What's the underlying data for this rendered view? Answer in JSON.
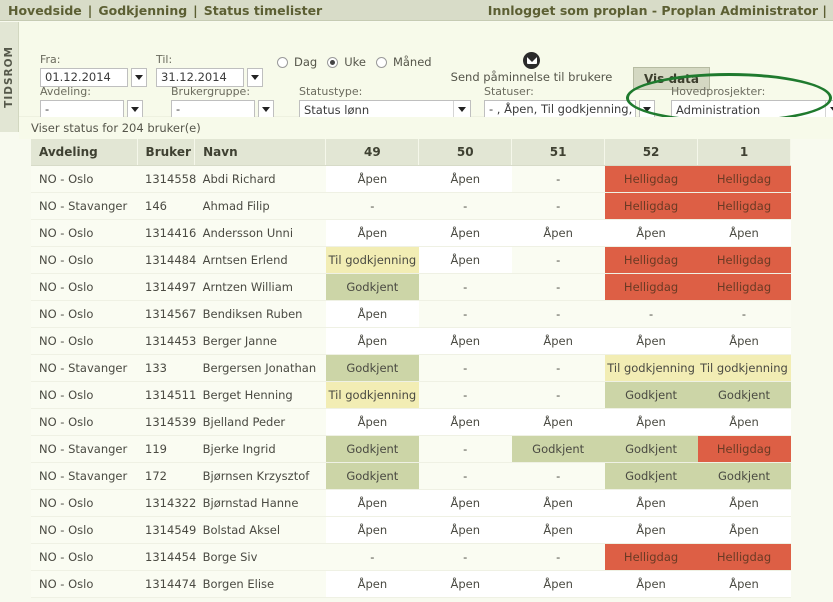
{
  "topbar": {
    "nav": [
      "Hovedside",
      "Godkjenning",
      "Status timelister"
    ],
    "separator": "|",
    "right_text": "Innlogget som proplan - Proplan Administrator |"
  },
  "sidetab": {
    "label": "TIDSROM"
  },
  "filters": {
    "fra": {
      "label": "Fra:",
      "value": "01.12.2014"
    },
    "til": {
      "label": "Til:",
      "value": "31.12.2014"
    },
    "period": {
      "options": [
        "Dag",
        "Uke",
        "Måned"
      ],
      "selected": "Uke"
    },
    "send_reminder": {
      "label": "Send påminnelse til brukere",
      "icon": "envelope-icon"
    },
    "vis_data": {
      "label": "Vis data"
    },
    "avdeling": {
      "label": "Avdeling:",
      "value": "-"
    },
    "brukergruppe": {
      "label": "Brukergruppe:",
      "value": "-"
    },
    "statustype": {
      "label": "Statustype:",
      "value": "Status lønn"
    },
    "statuser": {
      "label": "Statuser:",
      "value": "- , Åpen, Til godkjenning, G"
    },
    "hovedprosjekter": {
      "label": "Hovedprosjekter:",
      "value": "Administration"
    }
  },
  "status_line": "Viser status for 204 bruker(e)",
  "table": {
    "headers": [
      "Avdeling",
      "Bruker",
      "Navn",
      "49",
      "50",
      "51",
      "52",
      "1"
    ],
    "rows": [
      {
        "avdeling": "NO - Oslo",
        "bruker": "1314558",
        "navn": "Abdi Richard",
        "weeks": [
          "Åpen",
          "Åpen",
          "-",
          "Helligdag",
          "Helligdag"
        ]
      },
      {
        "avdeling": "NO - Stavanger",
        "bruker": "146",
        "navn": "Ahmad Filip",
        "weeks": [
          "-",
          "-",
          "-",
          "Helligdag",
          "Helligdag"
        ]
      },
      {
        "avdeling": "NO - Oslo",
        "bruker": "1314416",
        "navn": "Andersson Unni",
        "weeks": [
          "Åpen",
          "Åpen",
          "Åpen",
          "Åpen",
          "Åpen"
        ]
      },
      {
        "avdeling": "NO - Oslo",
        "bruker": "1314484",
        "navn": "Arntsen Erlend",
        "weeks": [
          "Til godkjenning",
          "Åpen",
          "-",
          "Helligdag",
          "Helligdag"
        ]
      },
      {
        "avdeling": "NO - Oslo",
        "bruker": "1314497",
        "navn": "Arntzen William",
        "weeks": [
          "Godkjent",
          "-",
          "-",
          "Helligdag",
          "Helligdag"
        ]
      },
      {
        "avdeling": "NO - Oslo",
        "bruker": "1314567",
        "navn": "Bendiksen Ruben",
        "weeks": [
          "Åpen",
          "-",
          "-",
          "-",
          "-"
        ]
      },
      {
        "avdeling": "NO - Oslo",
        "bruker": "1314453",
        "navn": "Berger Janne",
        "weeks": [
          "Åpen",
          "Åpen",
          "Åpen",
          "Åpen",
          "Åpen"
        ]
      },
      {
        "avdeling": "NO - Stavanger",
        "bruker": "133",
        "navn": "Bergersen Jonathan",
        "weeks": [
          "Godkjent",
          "-",
          "-",
          "Til godkjenning",
          "Til godkjenning"
        ]
      },
      {
        "avdeling": "NO - Oslo",
        "bruker": "1314511",
        "navn": "Berget Henning",
        "weeks": [
          "Til godkjenning",
          "-",
          "-",
          "Godkjent",
          "Godkjent"
        ]
      },
      {
        "avdeling": "NO - Oslo",
        "bruker": "1314539",
        "navn": "Bjelland Peder",
        "weeks": [
          "Åpen",
          "Åpen",
          "Åpen",
          "Åpen",
          "Åpen"
        ]
      },
      {
        "avdeling": "NO - Stavanger",
        "bruker": "119",
        "navn": "Bjerke Ingrid",
        "weeks": [
          "Godkjent",
          "-",
          "Godkjent",
          "Godkjent",
          "Helligdag"
        ]
      },
      {
        "avdeling": "NO - Stavanger",
        "bruker": "172",
        "navn": "Bjørnsen Krzysztof",
        "weeks": [
          "Godkjent",
          "-",
          "-",
          "Godkjent",
          "Godkjent"
        ]
      },
      {
        "avdeling": "NO - Oslo",
        "bruker": "1314322",
        "navn": "Bjørnstad Hanne",
        "weeks": [
          "Åpen",
          "Åpen",
          "Åpen",
          "Åpen",
          "Åpen"
        ]
      },
      {
        "avdeling": "NO - Oslo",
        "bruker": "1314549",
        "navn": "Bolstad Aksel",
        "weeks": [
          "Åpen",
          "Åpen",
          "Åpen",
          "Åpen",
          "Åpen"
        ]
      },
      {
        "avdeling": "NO - Oslo",
        "bruker": "1314454",
        "navn": "Borge Siv",
        "weeks": [
          "-",
          "-",
          "-",
          "Helligdag",
          "Helligdag"
        ]
      },
      {
        "avdeling": "NO - Oslo",
        "bruker": "1314474",
        "navn": "Borgen Elise",
        "weeks": [
          "Åpen",
          "Åpen",
          "Åpen",
          "Åpen",
          "Åpen"
        ]
      }
    ]
  },
  "colors": {
    "apen": "#ffffff",
    "til_godkjenning": "#f2edb4",
    "godkjent": "#ccd5a7",
    "helligdag": "#dd5f45",
    "header_bg": "#e2e6d4",
    "topbar_bg": "#d8dcc8",
    "annotation_green": "#1f7a2e"
  }
}
